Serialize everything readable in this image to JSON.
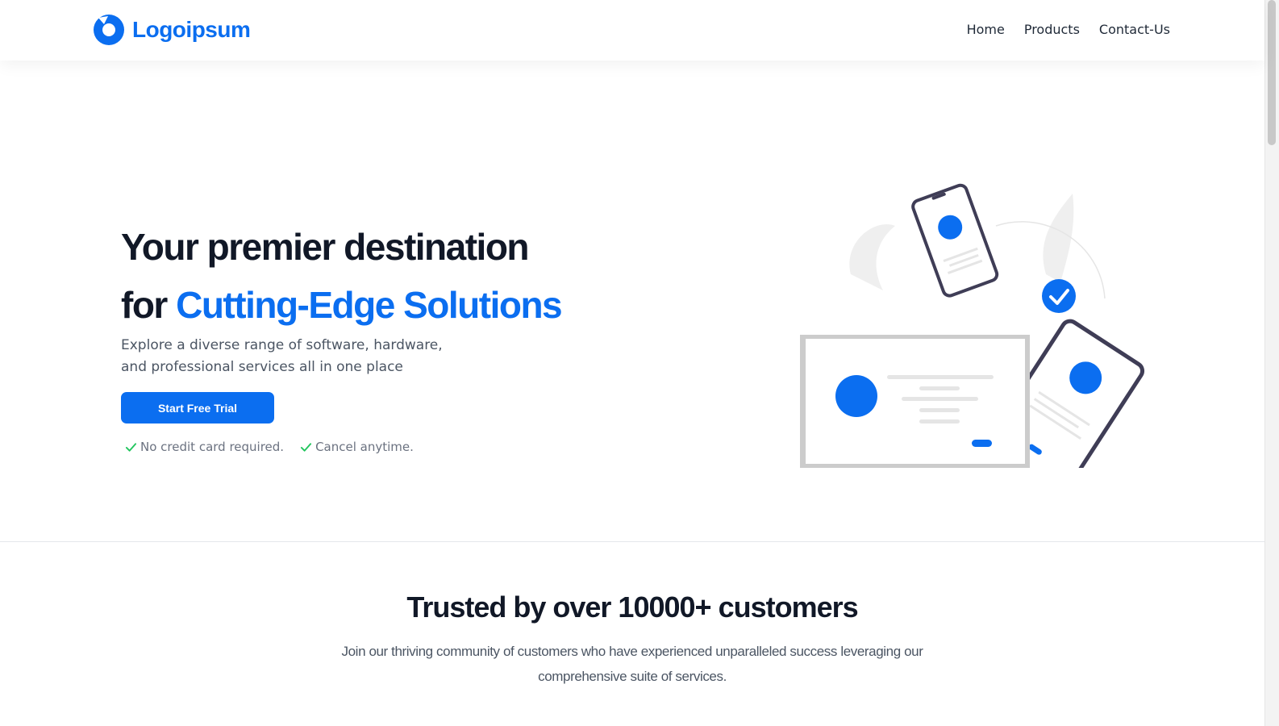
{
  "brand": {
    "name": "Logoipsum",
    "accent_color": "#0b6ef0"
  },
  "nav": {
    "items": [
      {
        "label": "Home"
      },
      {
        "label": "Products"
      },
      {
        "label": "Contact-Us"
      }
    ]
  },
  "hero": {
    "headline_line1": "Your premier destination",
    "headline_line2_prefix": "for ",
    "headline_line2_accent": "Cutting-Edge Solutions",
    "subtext_line1": "Explore a diverse range of software, hardware,",
    "subtext_line2": "and professional services all in one place",
    "cta_label": "Start Free Trial",
    "benefits": [
      {
        "label": "No credit card required.",
        "icon": "check-icon"
      },
      {
        "label": "Cancel anytime.",
        "icon": "check-icon"
      }
    ],
    "illustration": "devices-illustration"
  },
  "trust": {
    "title": "Trusted by over 10000+ customers",
    "description": "Join our thriving community of customers who have experienced unparalleled success leveraging our comprehensive suite of services."
  }
}
